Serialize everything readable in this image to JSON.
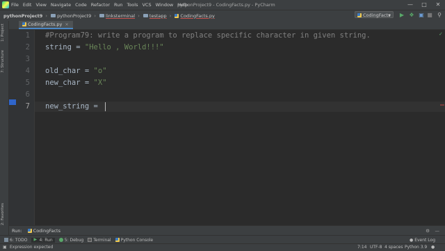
{
  "window": {
    "title": "pythonProject9 - CodingFacts.py - PyCharm"
  },
  "menu": [
    "File",
    "Edit",
    "View",
    "Navigate",
    "Code",
    "Refactor",
    "Run",
    "Tools",
    "VCS",
    "Window",
    "Help"
  ],
  "breadcrumbs": [
    "pythonProject9",
    "pythonProject9",
    "linksterminal",
    "testapp",
    "CodingFacts.py"
  ],
  "run_config": {
    "label": "CodingFacts"
  },
  "left_tabs": {
    "project": "1: Project",
    "structure": "7: Structure",
    "favorites": "2: Favorites"
  },
  "tab": {
    "label": "CodingFacts.py"
  },
  "editor": {
    "line_numbers": [
      "1",
      "2",
      "3",
      "4",
      "5",
      "6",
      "7"
    ],
    "lines": [
      {
        "comment": "#Program79: write a program to replace specific character in given string."
      },
      {
        "code": "string = ",
        "str": "\"Hello , World!!!\""
      },
      {
        "code": ""
      },
      {
        "code": "old_char = ",
        "str": "\"o\""
      },
      {
        "code": "new_char = ",
        "str": "\"X\""
      },
      {
        "code": ""
      },
      {
        "code": "new_string = "
      }
    ]
  },
  "run_panel": {
    "label": "Run:",
    "config": "CodingFacts"
  },
  "tool_tabs": [
    "6: TODO",
    "4: Run",
    "5: Debug",
    "Terminal",
    "Python Console"
  ],
  "event_log": "Event Log",
  "status": {
    "message": "Expression expected",
    "position": "7:14",
    "encoding": "UTF-8",
    "indent": "4 spaces",
    "interpreter": "Python 3.9"
  },
  "colors": {
    "accent": "#4a88c7",
    "comment": "#808080",
    "string": "#6a8759",
    "run": "#59a869"
  }
}
